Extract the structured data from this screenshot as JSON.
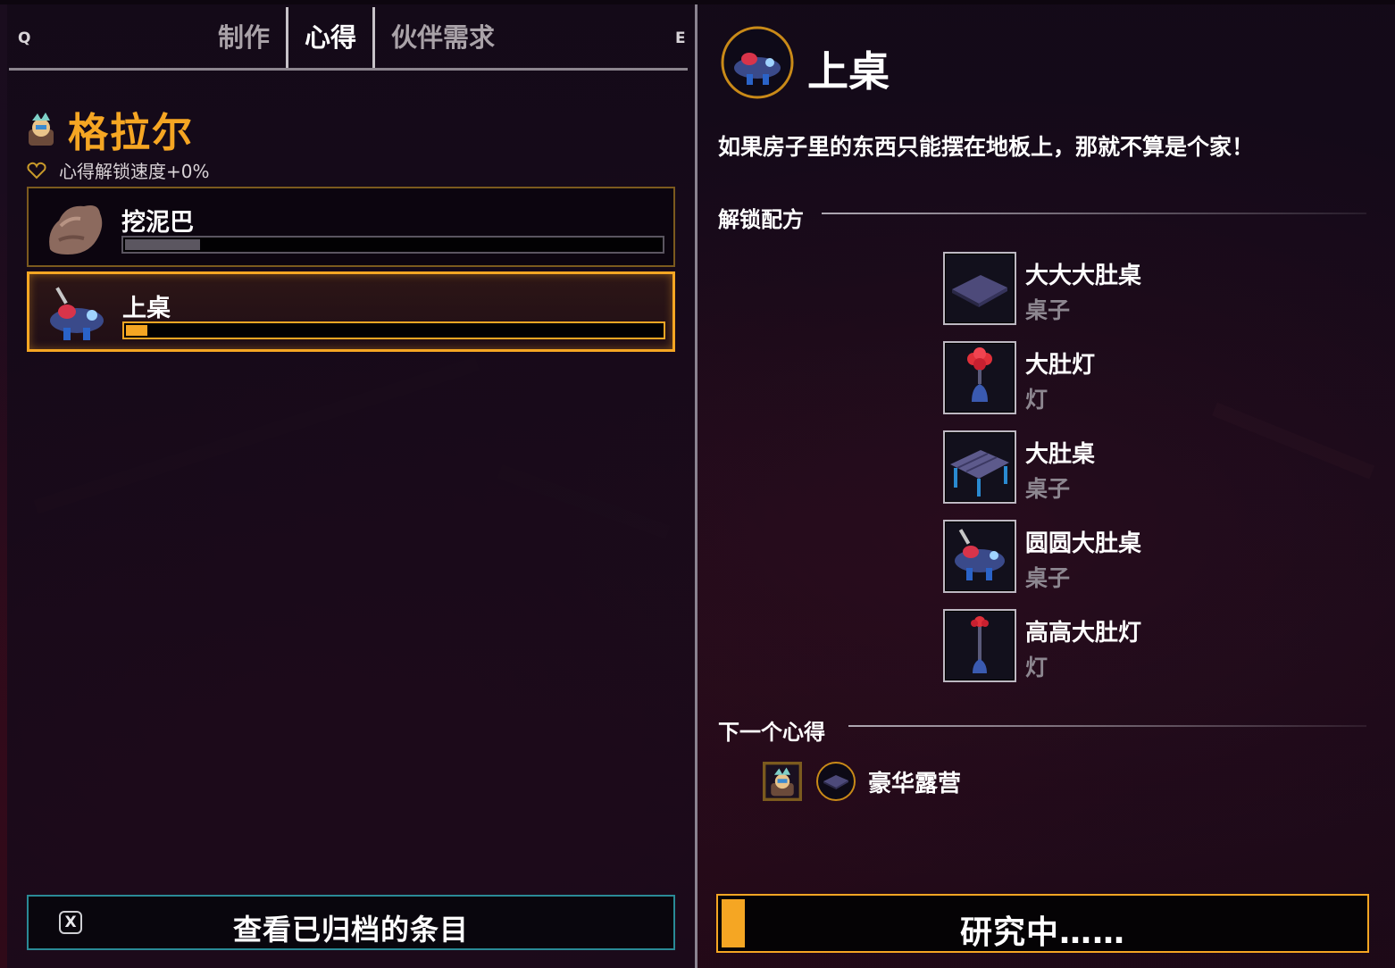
{
  "colors": {
    "accent": "#f5a623",
    "tab_inactive": "#a9a2a8",
    "subtext": "#8d8790",
    "archive_border": "#2a8a96"
  },
  "header": {
    "key_prev": "Q",
    "key_next": "E",
    "tabs": [
      {
        "label": "制作",
        "active": false
      },
      {
        "label": "心得",
        "active": true
      },
      {
        "label": "伙伴需求",
        "active": false
      }
    ]
  },
  "npc": {
    "name": "格拉尔",
    "avatar_icon": "npc-portrait-icon",
    "speed_icon": "heart-outline-icon",
    "unlock_speed": "心得解锁速度+0%"
  },
  "insights": [
    {
      "title": "挖泥巴",
      "icon": "mud-lump-icon",
      "progress": 0.14,
      "bar_color": "#5b5660",
      "active": false
    },
    {
      "title": "上桌",
      "icon": "round-table-icon",
      "progress": 0.04,
      "bar_color": "#f5a623",
      "active": true
    }
  ],
  "archive_button": {
    "key": "X",
    "label": "查看已归档的条目"
  },
  "detail": {
    "title": "上桌",
    "icon": "round-table-icon",
    "description": "如果房子里的东西只能摆在地板上，那就不算是个家！",
    "unlock_section": "解锁配方",
    "recipes": [
      {
        "name": "大大大肚桌",
        "type": "桌子",
        "icon": "flat-table-icon"
      },
      {
        "name": "大肚灯",
        "type": "灯",
        "icon": "flower-lamp-icon"
      },
      {
        "name": "大肚桌",
        "type": "桌子",
        "icon": "plank-table-icon"
      },
      {
        "name": "圆圆大肚桌",
        "type": "桌子",
        "icon": "round-table-icon"
      },
      {
        "name": "高高大肚灯",
        "type": "灯",
        "icon": "tall-lamp-icon"
      }
    ],
    "next_section": "下一个心得",
    "next": {
      "name": "豪华露营",
      "avatar_icon": "npc-portrait-icon",
      "icon": "flat-table-icon"
    }
  },
  "research_button": {
    "label": "研究中……",
    "progress": 0.04
  }
}
